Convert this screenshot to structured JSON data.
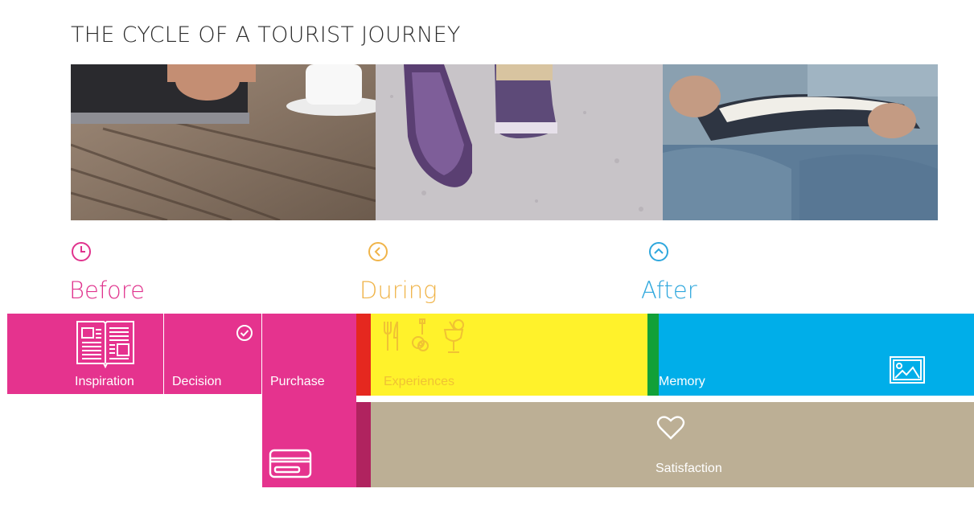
{
  "title": "THE CYCLE OF A TOURIST JOURNEY",
  "phases": [
    {
      "label": "Before",
      "icon": "clock-icon",
      "color": "#e0338d"
    },
    {
      "label": "During",
      "icon": "chevron-left-circle-icon",
      "color": "#f0b449"
    },
    {
      "label": "After",
      "icon": "chevron-up-circle-icon",
      "color": "#2ea7dd"
    }
  ],
  "photos": [
    {
      "name": "tablet-on-table-photo",
      "icon": "photo-tablet"
    },
    {
      "name": "walking-sneakers-photo",
      "icon": "photo-sneakers"
    },
    {
      "name": "reading-book-photo",
      "icon": "photo-book"
    }
  ],
  "stages": {
    "inspiration": {
      "label": "Inspiration",
      "icon": "newspaper-icon"
    },
    "decision": {
      "label": "Decision",
      "icon": "check-circle-icon"
    },
    "purchase": {
      "label": "Purchase",
      "icon": "credit-card-icon"
    },
    "experiences": {
      "label": "Experiences",
      "icons": [
        "fork-knife-icon",
        "guitar-icon",
        "cocktail-icon"
      ]
    },
    "memory": {
      "label": "Memory",
      "icon": "picture-icon"
    },
    "satisfaction": {
      "label": "Satisfaction",
      "icon": "heart-icon"
    }
  },
  "colors": {
    "pink": "#e5338e",
    "dark_pink": "#b0235f",
    "red": "#e5281f",
    "yellow": "#fff22b",
    "experiences_text": "#f0c233",
    "green": "#12a038",
    "blue": "#00aee9",
    "tan": "#bcaf95"
  }
}
